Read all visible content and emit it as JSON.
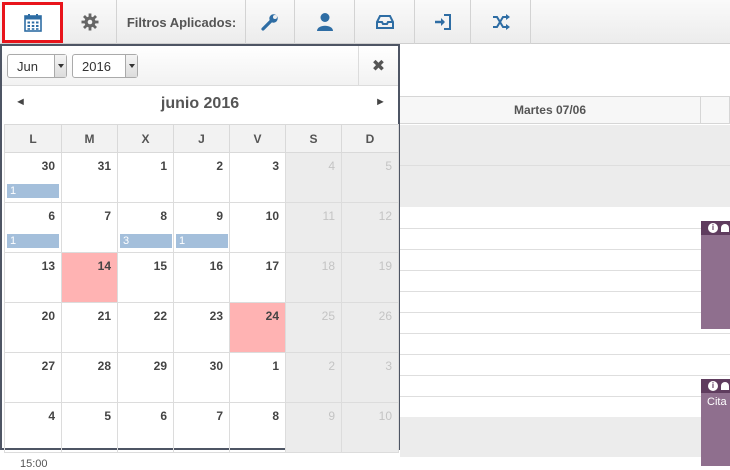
{
  "toolbar": {
    "filters_label": "Filtros Aplicados:"
  },
  "schedule": {
    "day_header": "Martes 07/06",
    "event_text": "Cita c",
    "time_label": "15:00"
  },
  "calendar": {
    "month_select": "Jun",
    "year_select": "2016",
    "close": "✖",
    "prev": "◄",
    "next": "►",
    "title": "junio 2016",
    "weekdays": [
      "L",
      "M",
      "X",
      "J",
      "V",
      "S",
      "D"
    ],
    "weeks": [
      [
        {
          "d": "30",
          "badge": "1"
        },
        {
          "d": "31"
        },
        {
          "d": "1"
        },
        {
          "d": "2"
        },
        {
          "d": "3"
        },
        {
          "d": "4"
        },
        {
          "d": "5"
        }
      ],
      [
        {
          "d": "6",
          "badge": "1"
        },
        {
          "d": "7"
        },
        {
          "d": "8",
          "badge": "3"
        },
        {
          "d": "9",
          "badge": "1"
        },
        {
          "d": "10"
        },
        {
          "d": "11"
        },
        {
          "d": "12"
        }
      ],
      [
        {
          "d": "13"
        },
        {
          "d": "14"
        },
        {
          "d": "15"
        },
        {
          "d": "16"
        },
        {
          "d": "17"
        },
        {
          "d": "18"
        },
        {
          "d": "19"
        }
      ],
      [
        {
          "d": "20"
        },
        {
          "d": "21"
        },
        {
          "d": "22"
        },
        {
          "d": "23"
        },
        {
          "d": "24"
        },
        {
          "d": "25"
        },
        {
          "d": "26"
        }
      ],
      [
        {
          "d": "27"
        },
        {
          "d": "28"
        },
        {
          "d": "29"
        },
        {
          "d": "30"
        },
        {
          "d": "1"
        },
        {
          "d": "2"
        },
        {
          "d": "3"
        }
      ],
      [
        {
          "d": "4"
        },
        {
          "d": "5"
        },
        {
          "d": "6"
        },
        {
          "d": "7"
        },
        {
          "d": "8"
        },
        {
          "d": "9"
        },
        {
          "d": "10"
        }
      ]
    ],
    "highlight_color": "#ffb3b3",
    "badge_color": "#a4bfdb"
  },
  "colors": {
    "icon_blue": "#2e6da4",
    "selected_border": "#e8141b",
    "event_color": "#8f6f8e"
  }
}
